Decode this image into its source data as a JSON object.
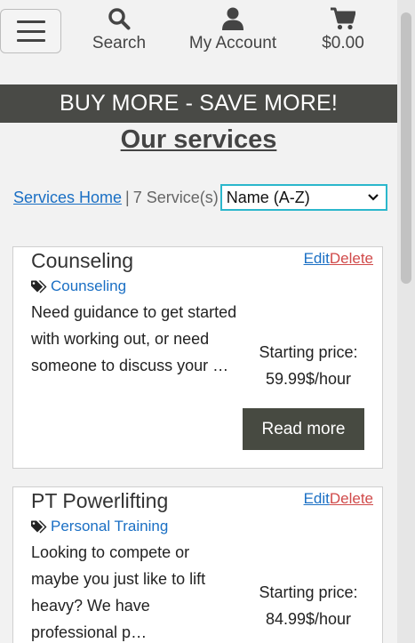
{
  "header": {
    "nav": {
      "search_label": "Search",
      "account_label": "My Account",
      "cart_total": "$0.00"
    }
  },
  "promo_banner": "BUY MORE - SAVE MORE!",
  "page_title": "Our services",
  "filter": {
    "breadcrumb_link": "Services Home",
    "separator": "|",
    "count_text": "7 Service(s)",
    "sort_selected": "Name (A-Z)"
  },
  "services": [
    {
      "title": "Counseling",
      "edit_label": "Edit",
      "delete_label": "Delete",
      "category": "Counseling",
      "description": "Need guidance to get started with working out, or need someone to discuss your …",
      "price_label": "Starting price:",
      "price": "59.99$/hour",
      "read_more_label": "Read more"
    },
    {
      "title": "PT Powerlifting",
      "edit_label": "Edit",
      "delete_label": "Delete",
      "category": "Personal Training",
      "description": "Looking to compete or maybe you just like to lift heavy? We have professional p…",
      "price_label": "Starting price:",
      "price": "84.99$/hour"
    }
  ],
  "colors": {
    "banner_bg": "#494a46",
    "link": "#1a6fc4",
    "delete": "#d04a4a",
    "button_bg": "#474a41",
    "select_border": "#2bb7cc"
  },
  "icons": {
    "menu": "hamburger-icon",
    "search": "search-icon",
    "account": "user-icon",
    "cart": "cart-icon",
    "tag": "tags-icon",
    "dropdown": "chevron-down-icon"
  }
}
